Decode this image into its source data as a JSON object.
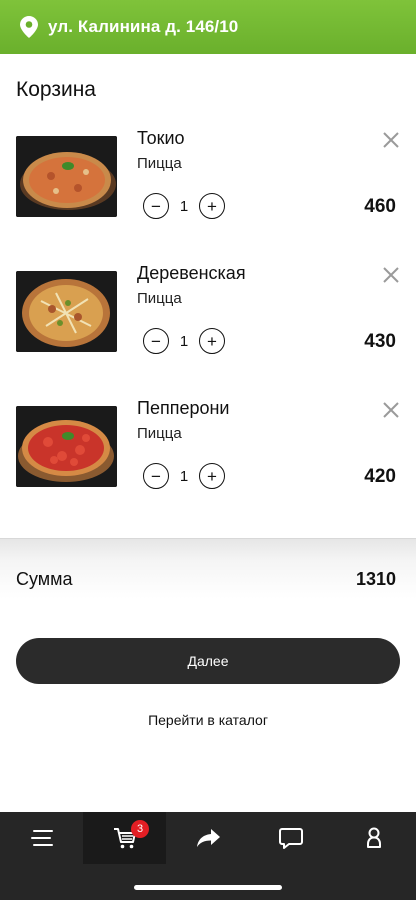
{
  "header": {
    "address": "ул. Калинина д. 146/10",
    "icon": "location-pin-icon"
  },
  "cart": {
    "title": "Корзина",
    "items": [
      {
        "name": "Токио",
        "category": "Пицца",
        "quantity": "1",
        "price": "460",
        "image": "pizza-tokio-image"
      },
      {
        "name": "Деревенская",
        "category": "Пицца",
        "quantity": "1",
        "price": "430",
        "image": "pizza-derevenskaya-image"
      },
      {
        "name": "Пепперони",
        "category": "Пицца",
        "quantity": "1",
        "price": "420",
        "image": "pizza-pepperoni-image"
      }
    ],
    "minus_symbol": "−",
    "plus_symbol": "+"
  },
  "summary": {
    "label": "Сумма",
    "total": "1310"
  },
  "actions": {
    "next_label": "Далее",
    "catalog_label": "Перейти в каталог"
  },
  "tabbar": {
    "tabs": [
      {
        "icon": "menu-icon"
      },
      {
        "icon": "cart-icon",
        "badge": "3",
        "active": true
      },
      {
        "icon": "share-icon"
      },
      {
        "icon": "chat-icon"
      },
      {
        "icon": "profile-icon"
      }
    ]
  },
  "colors": {
    "header_green": "#6ab02c",
    "button_dark": "#2b2b2b",
    "tabbar_bg": "#262626",
    "badge_red": "#e31e24"
  }
}
